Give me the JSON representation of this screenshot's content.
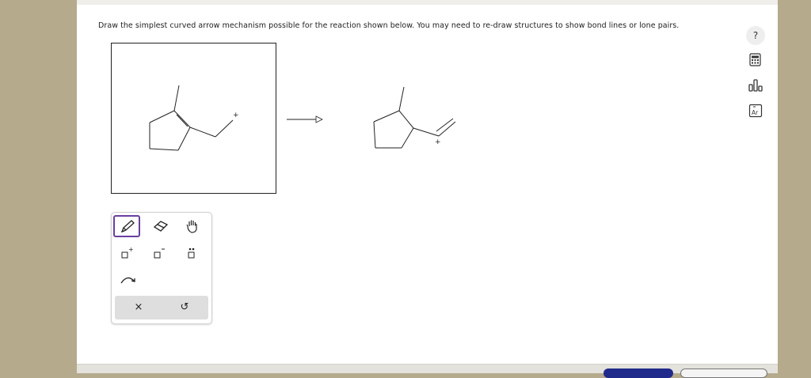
{
  "question": {
    "prompt": "Draw the simplest curved arrow mechanism possible for the reaction shown below. You may need to re-draw structures to show bond lines or lone pairs."
  },
  "structures": {
    "reactant_charge": "+",
    "product_charge": "+"
  },
  "side_toolbar": {
    "help_label": "?",
    "icons": [
      "calculator-icon",
      "periodic-chart-icon",
      "element-table-icon"
    ],
    "element_symbol": "Ar"
  },
  "palette": {
    "tools": [
      "pencil-icon",
      "eraser-icon",
      "hand-icon",
      "positive-charge-icon",
      "negative-charge-icon",
      "lone-pair-icon",
      "curved-arrow-icon"
    ],
    "selected_tool": "pencil-icon",
    "clear_label": "×",
    "undo_label": "↺"
  },
  "colors": {
    "accent": "#6b3fa0",
    "submit": "#1f2a8a",
    "background": "#b5aa8c"
  }
}
